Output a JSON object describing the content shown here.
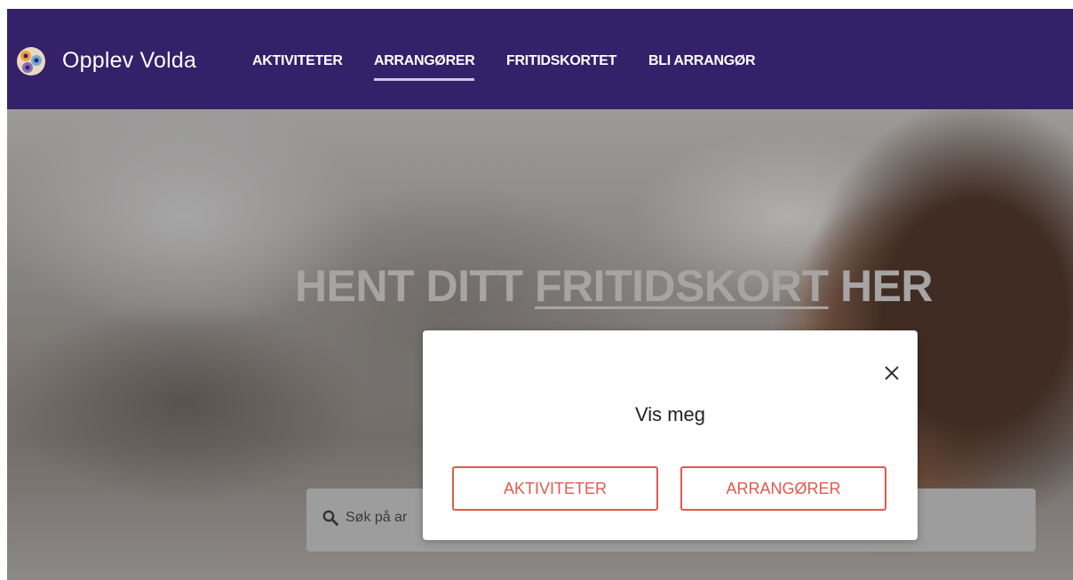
{
  "brand": {
    "name": "Opplev Volda",
    "logo_icon": "opplev-volda-logo-icon"
  },
  "nav": {
    "items": [
      {
        "label": "AKTIVITETER",
        "active": false
      },
      {
        "label": "ARRANGØRER",
        "active": true
      },
      {
        "label": "FRITIDSKORTET",
        "active": false
      },
      {
        "label": "BLI ARRANGØR",
        "active": false
      }
    ]
  },
  "hero": {
    "title_before": "HENT DITT ",
    "title_link": "FRITIDSKORT",
    "title_after": " HER"
  },
  "search": {
    "icon": "search-icon",
    "placeholder": "Søk på ar"
  },
  "modal": {
    "title": "Vis meg",
    "close_icon": "close-icon",
    "buttons": [
      {
        "label": "AKTIVITETER"
      },
      {
        "label": "ARRANGØRER"
      }
    ]
  },
  "colors": {
    "nav_background": "#35206a",
    "accent": "#e05a4e",
    "text_dark": "#222222"
  }
}
